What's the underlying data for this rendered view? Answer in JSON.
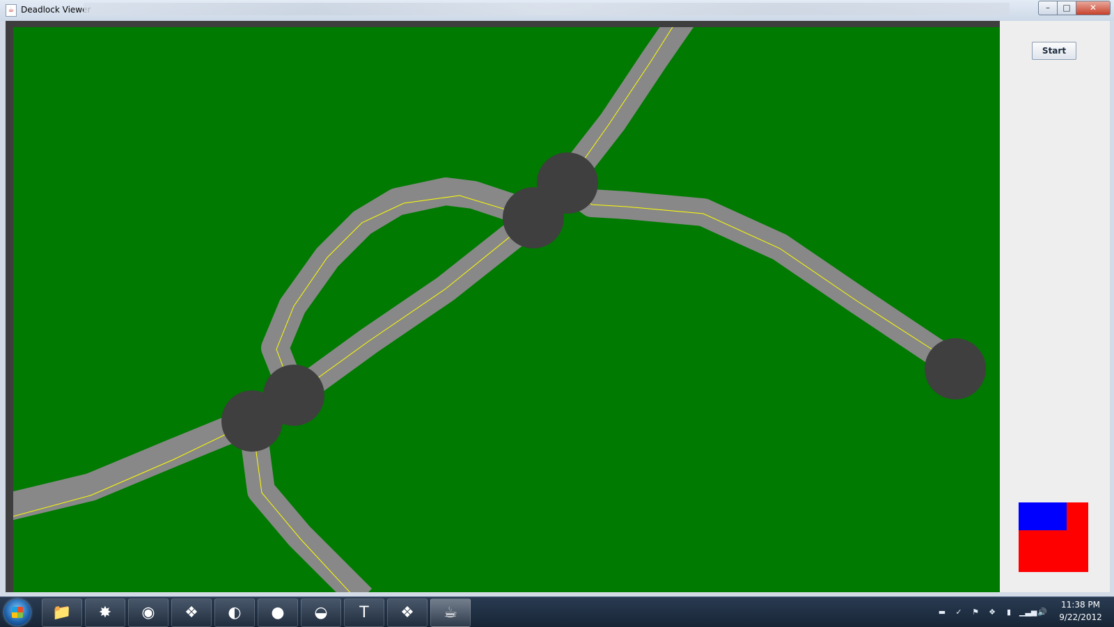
{
  "window": {
    "title": "Deadlock Viewer"
  },
  "title_controls": {
    "minimize": "–",
    "maximize": "□",
    "close": "✕"
  },
  "panel": {
    "start_label": "Start"
  },
  "colors": {
    "background": "#007a00",
    "road": "#888888",
    "path": "#ffff00",
    "node": "#3f3f3f",
    "status_primary": "#ff0000",
    "status_secondary": "#0000ff"
  },
  "taskbar": {
    "apps": [
      {
        "icon": "folder-icon",
        "glyph": "📁"
      },
      {
        "icon": "starburst-app-icon",
        "glyph": "✸"
      },
      {
        "icon": "chrome-icon",
        "glyph": "◉"
      },
      {
        "icon": "windows-explorer-icon",
        "glyph": "❖"
      },
      {
        "icon": "eclipse-icon",
        "glyph": "◐"
      },
      {
        "icon": "cat-app-icon",
        "glyph": "●"
      },
      {
        "icon": "eclipse-blue-icon",
        "glyph": "◒"
      },
      {
        "icon": "editor-icon",
        "glyph": "T"
      },
      {
        "icon": "windows-flag-icon",
        "glyph": "❖"
      },
      {
        "icon": "java-icon",
        "glyph": "☕"
      }
    ],
    "tray": [
      {
        "icon": "console-icon",
        "glyph": "▬"
      },
      {
        "icon": "sync-check-icon",
        "glyph": "✓"
      },
      {
        "icon": "action-center-flag-icon",
        "glyph": "⚑"
      },
      {
        "icon": "windows-update-icon",
        "glyph": "❖"
      },
      {
        "icon": "power-icon",
        "glyph": "▮"
      },
      {
        "icon": "network-icon",
        "glyph": "▁▃▅"
      },
      {
        "icon": "volume-icon",
        "glyph": "🔊"
      }
    ],
    "clock": {
      "time": "11:38 PM",
      "date": "9/22/2012"
    }
  }
}
